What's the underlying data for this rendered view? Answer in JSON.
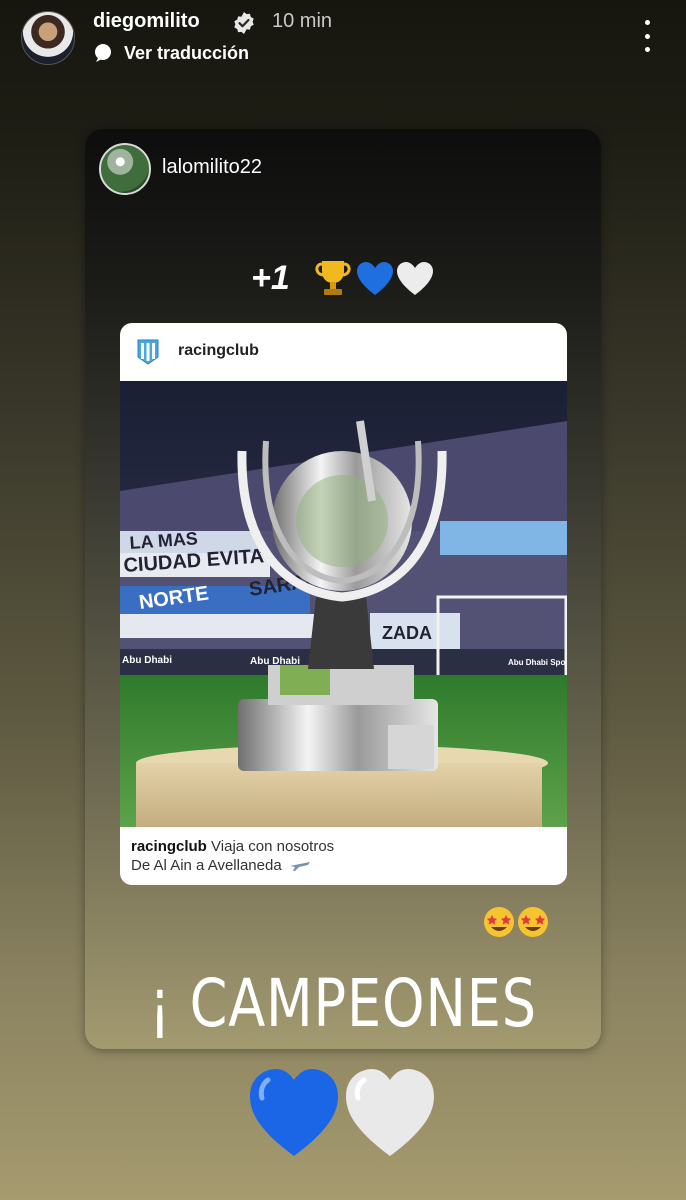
{
  "header": {
    "username": "diegomilito",
    "time": "10 min",
    "translate_label": "Ver traducción"
  },
  "shared_story": {
    "username": "lalomilito22",
    "plus_text": "+1",
    "post": {
      "username": "racingclub",
      "caption_user": "racingclub",
      "caption_line1": "Viaja con nosotros",
      "caption_line2": "De Al Ain a Avellaneda",
      "banner_texts": [
        "LA MAS",
        "CIUDAD EVITA",
        "NORTE",
        "SARAN",
        "ZADA",
        "Abu Dhabi",
        "Abu Dhabi Sports Council"
      ]
    },
    "headline": "¡ CAMPEONES !"
  },
  "colors": {
    "accent_blue": "#1f6fe0",
    "racing_blue": "#4aa8e0"
  },
  "icons": [
    "verified-badge-icon",
    "translate-icon",
    "more-options-icon",
    "trophy-icon",
    "blue-heart-icon",
    "white-heart-icon",
    "star-struck-emoji-icon",
    "airplane-icon",
    "racing-club-logo"
  ]
}
